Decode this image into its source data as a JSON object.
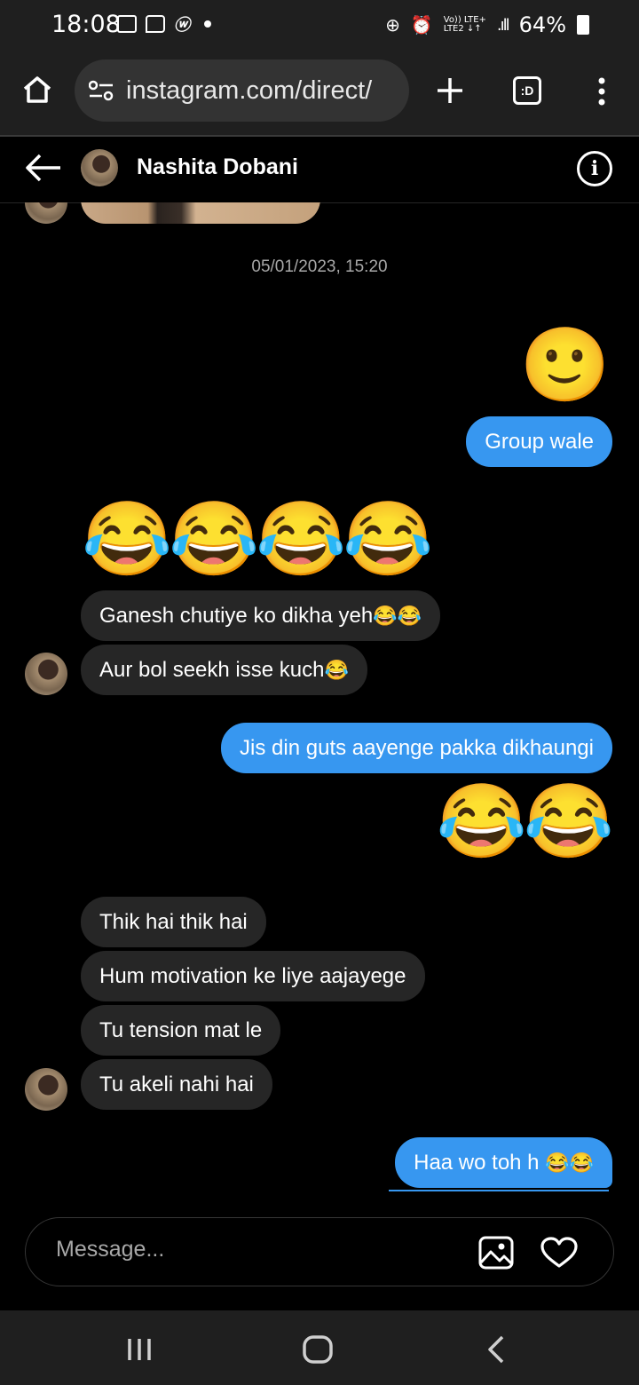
{
  "status_bar": {
    "time": "18:08",
    "network_top": "Vo)) LTE+",
    "network_bottom": "LTE2 ↓↑",
    "battery": "64%"
  },
  "browser": {
    "url": "instagram.com/direct/",
    "tabs_label": ":D"
  },
  "chat": {
    "contact_name": "Nashita Dobani",
    "timestamp": "05/01/2023, 15:20",
    "messages": [
      {
        "from": "me",
        "type": "emoji",
        "text": "🙂"
      },
      {
        "from": "me",
        "type": "text",
        "text": "Group wale"
      },
      {
        "from": "them",
        "type": "emoji",
        "text": "😂😂😂😂"
      },
      {
        "from": "them",
        "type": "text",
        "text": "Ganesh chutiye ko dikha yeh",
        "emoji": "😂😂"
      },
      {
        "from": "them",
        "type": "text",
        "text": "Aur bol seekh isse kuch",
        "emoji": "😂"
      },
      {
        "from": "me",
        "type": "text",
        "text": "Jis din guts aayenge pakka dikhaungi"
      },
      {
        "from": "me",
        "type": "emoji",
        "text": "😂😂"
      },
      {
        "from": "them",
        "type": "text",
        "text": "Thik hai thik hai"
      },
      {
        "from": "them",
        "type": "text",
        "text": "Hum motivation ke liye aajayege"
      },
      {
        "from": "them",
        "type": "text",
        "text": "Tu tension mat le"
      },
      {
        "from": "them",
        "type": "text",
        "text": "Tu akeli nahi hai"
      },
      {
        "from": "me",
        "type": "text",
        "text": "Haa wo toh h ",
        "emoji": "😂😂"
      }
    ]
  },
  "composer": {
    "placeholder": "Message..."
  },
  "icons": {
    "home": "home-icon",
    "site_settings": "site-settings-icon",
    "new_tab": "plus-icon",
    "menu": "more-vert-icon",
    "back": "back-arrow-icon",
    "info": "info-icon",
    "gallery": "image-icon",
    "like": "heart-icon"
  }
}
